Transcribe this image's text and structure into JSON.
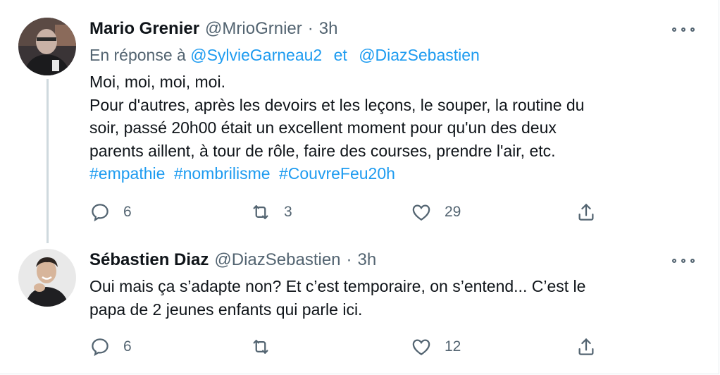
{
  "tweets": [
    {
      "name": "Mario Grenier",
      "handle": "@MrioGrnier",
      "separator": "·",
      "time": "3h",
      "reply_prefix": "En réponse à",
      "reply_mentions": [
        "@SylvieGarneau2",
        "@DiazSebastien"
      ],
      "reply_and": "et",
      "text": "Moi, moi, moi, moi.\nPour d'autres, après les devoirs et les leçons, le souper, la routine du\nsoir, passé 20h00 était un excellent moment pour qu'un des deux\nparents aillent, à tour de rôle, faire des courses, prendre l'air, etc.",
      "hashtags": [
        "#empathie",
        "#nombrilisme",
        "#CouvreFeu20h"
      ],
      "replies": "6",
      "retweets": "3",
      "likes": "29"
    },
    {
      "name": "Sébastien Diaz",
      "handle": "@DiazSebastien",
      "separator": "·",
      "time": "3h",
      "text": "Oui mais ça s’adapte non? Et c’est temporaire, on s’entend...  C’est le\npapa de 2 jeunes enfants qui parle ici.",
      "replies": "6",
      "retweets": "",
      "likes": "12"
    }
  ],
  "icons": {
    "reply": "reply-icon",
    "retweet": "retweet-icon",
    "like": "heart-icon",
    "share": "share-icon",
    "more": "more-icon"
  },
  "colors": {
    "link": "#1d9bf0",
    "secondary": "#536471",
    "text": "#0f1419",
    "thread_line": "#cfd9de"
  }
}
